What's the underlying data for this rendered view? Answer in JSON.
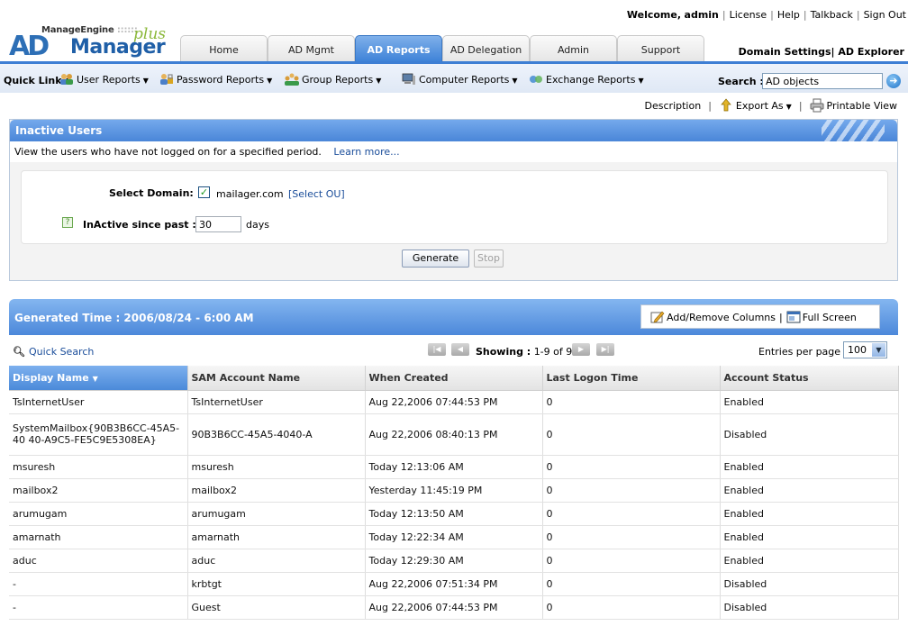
{
  "header": {
    "welcome": "Welcome,",
    "user": "admin",
    "links": [
      "License",
      "Help",
      "Talkback",
      "Sign Out"
    ],
    "logo": {
      "vendor": "ManageEngine",
      "vendor_dots": "::::::",
      "ad": "AD",
      "product": "Manager",
      "plus": "plus"
    },
    "tabs": [
      {
        "label": "Home",
        "active": false
      },
      {
        "label": "AD Mgmt",
        "active": false
      },
      {
        "label": "AD Reports",
        "active": true
      },
      {
        "label": "AD Delegation",
        "active": false
      },
      {
        "label": "Admin",
        "active": false
      },
      {
        "label": "Support",
        "active": false
      }
    ],
    "domain_settings": "Domain Settings",
    "ad_explorer": "AD Explorer"
  },
  "quickbar": {
    "label": "Quick Link :",
    "items": [
      {
        "label": "User Reports",
        "icon": "users-icon"
      },
      {
        "label": "Password Reports",
        "icon": "password-icon"
      },
      {
        "label": "Group Reports",
        "icon": "group-icon"
      },
      {
        "label": "Computer Reports",
        "icon": "computer-icon"
      },
      {
        "label": "Exchange Reports",
        "icon": "exchange-icon"
      }
    ],
    "search_label": "Search :",
    "search_value": "AD objects"
  },
  "actions": {
    "description": "Description",
    "export": "Export As",
    "printable": "Printable View"
  },
  "report": {
    "title": "Inactive Users",
    "description": "View the users who have not logged on for a specified period.",
    "learn_more": "Learn more...",
    "select_domain_label": "Select Domain:",
    "domain": "mailager.com",
    "select_ou": "[Select OU]",
    "inactive_label": "InActive since past :",
    "inactive_days": "30",
    "days_unit": "days",
    "generate": "Generate",
    "stop": "Stop"
  },
  "results": {
    "generated_time": "Generated Time : 2006/08/24 - 6:00 AM",
    "add_remove_columns": "Add/Remove Columns",
    "full_screen": "Full Screen",
    "quick_search": "Quick Search",
    "showing_label": "Showing :",
    "showing_range": "1-9 of 9",
    "entries_per_page_label": "Entries per page",
    "entries_per_page": "100",
    "columns": [
      "Display Name",
      "SAM Account Name",
      "When Created",
      "Last Logon Time",
      "Account Status"
    ],
    "rows": [
      [
        "TsInternetUser",
        "TsInternetUser",
        "Aug 22,2006 07:44:53 PM",
        "0",
        "Enabled"
      ],
      [
        "SystemMailbox{90B3B6CC-45A5-40 40-A9C5-FE5C9E5308EA}",
        "90B3B6CC-45A5-4040-A",
        "Aug 22,2006 08:40:13 PM",
        "0",
        "Disabled"
      ],
      [
        "msuresh",
        "msuresh",
        "Today 12:13:06 AM",
        "0",
        "Enabled"
      ],
      [
        "mailbox2",
        "mailbox2",
        "Yesterday 11:45:19 PM",
        "0",
        "Enabled"
      ],
      [
        "arumugam",
        "arumugam",
        "Today 12:13:50 AM",
        "0",
        "Enabled"
      ],
      [
        "amarnath",
        "amarnath",
        "Today 12:22:34 AM",
        "0",
        "Enabled"
      ],
      [
        "aduc",
        "aduc",
        "Today 12:29:30 AM",
        "0",
        "Enabled"
      ],
      [
        "-",
        "krbtgt",
        "Aug 22,2006 07:51:34 PM",
        "0",
        "Disabled"
      ],
      [
        "-",
        "Guest",
        "Aug 22,2006 07:44:53 PM",
        "0",
        "Disabled"
      ]
    ]
  }
}
